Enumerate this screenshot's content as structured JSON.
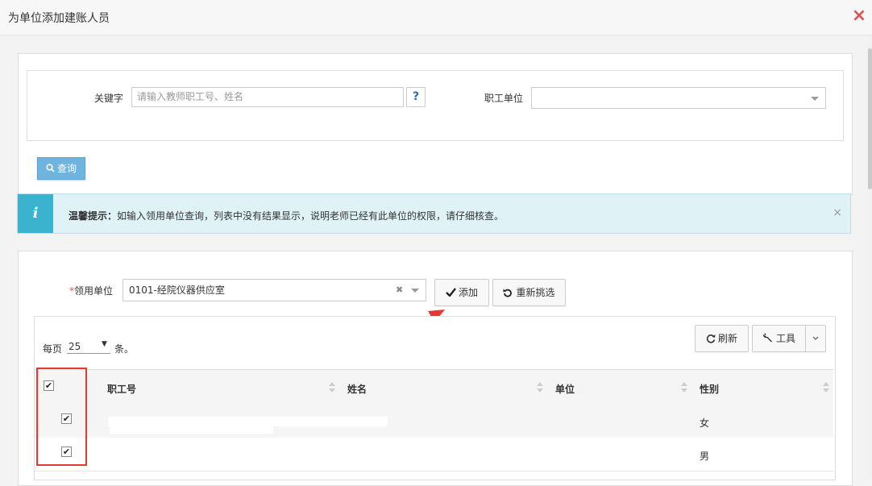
{
  "dialog": {
    "title": "为单位添加建账人员",
    "close_icon": "×"
  },
  "search": {
    "keyword_label": "关键字",
    "keyword_placeholder": "请输入教师职工号、姓名",
    "help_label": "?",
    "unit_label": "职工单位",
    "unit_value": "",
    "query_label": "查询"
  },
  "alert": {
    "title": "温馨提示：",
    "text": "如输入领用单位查询，列表中没有结果显示，说明老师已经有此单位的权限，请仔细核查。",
    "close": "×",
    "icon": "i"
  },
  "assign": {
    "required_mark": "*",
    "dept_label": "领用单位",
    "dept_value": "0101-经院仪器供应室",
    "clear": "✖",
    "add_label": "添加",
    "reselect_label": "重新挑选"
  },
  "grid_toolbar": {
    "per_page_prefix": "每页",
    "per_page_value": "25",
    "per_page_suffix": "条。",
    "refresh_label": "刷新",
    "tools_label": "工具"
  },
  "table": {
    "columns": [
      "职工号",
      "姓名",
      "单位",
      "性别"
    ],
    "rows": [
      {
        "id": "",
        "name": "",
        "unit": "",
        "gender": "女"
      },
      {
        "id": "",
        "name": "",
        "unit": "",
        "gender": "男"
      }
    ]
  },
  "colors": {
    "accent": "#6fb3e0",
    "info": "#3bb3cf",
    "danger": "#e53935"
  }
}
